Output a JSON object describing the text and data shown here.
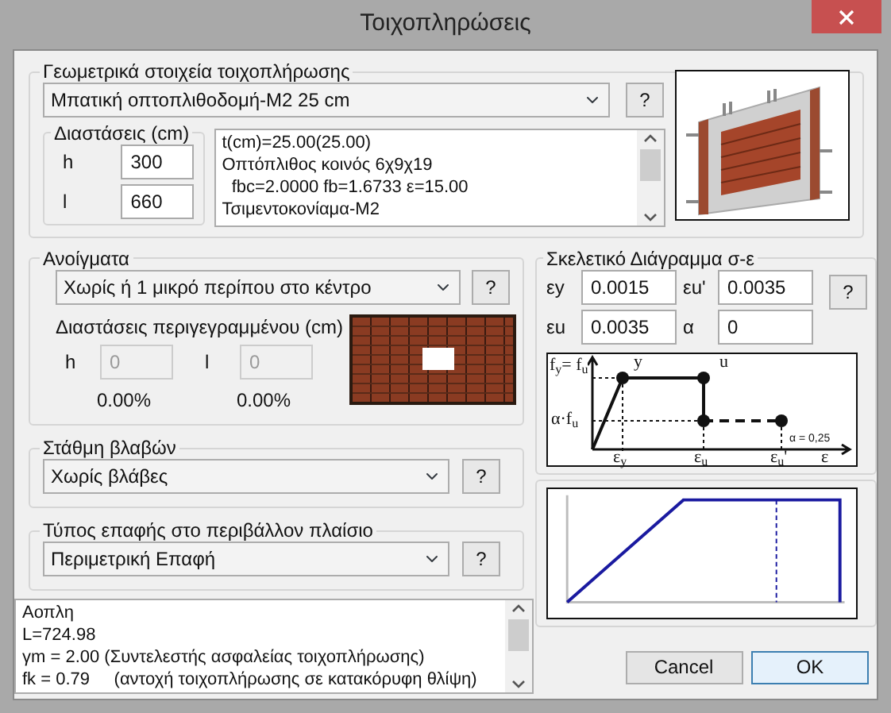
{
  "window": {
    "title": "Τοιχοπληρώσεις"
  },
  "geometry": {
    "label": "Γεωμετρικά στοιχεία τοιχοπλήρωσης",
    "type_select": "Μπατική οπτοπλιθοδομή-Μ2 25 cm",
    "help_button": "?",
    "dimensions": {
      "label": "Διαστάσεις (cm)",
      "fields": [
        {
          "label": "h",
          "value": "300",
          "disabled": false
        },
        {
          "label": "l",
          "value": "660",
          "disabled": false
        }
      ]
    },
    "info_lines": [
      "t(cm)=25.00(25.00)",
      "Οπτόπλιθος κοινός 6χ9χ19",
      "  fbc=2.0000 fb=1.6733 ε=15.00",
      "Τσιμεντοκονίαμα-Μ2"
    ]
  },
  "openings": {
    "label": "Ανοίγματα",
    "select": "Χωρίς ή 1 μικρό περίπου στο κέντρο",
    "help_button": "?",
    "outline_label": "Διαστάσεις περιγεγραμμένου (cm)",
    "fields": [
      {
        "label": "h",
        "value": "0",
        "disabled": true,
        "percent": "0.00%"
      },
      {
        "label": "l",
        "value": "0",
        "disabled": true,
        "percent": "0.00%"
      }
    ]
  },
  "damage": {
    "label": "Στάθμη βλαβών",
    "select": "Χωρίς βλάβες",
    "help_button": "?"
  },
  "contact": {
    "label": "Τύπος επαφής στο περιβάλλον πλαίσιο",
    "select": "Περιμετρική Επαφή",
    "help_button": "?"
  },
  "summary_lines": [
    "Αοπλη",
    "L=724.98",
    "γm = 2.00 (Συντελεστής ασφαλείας τοιχοπλήρωσης)",
    "fk = 0.79     (αντοχή τοιχοπλήρωσης σε κατακόρυφη θλίψη)"
  ],
  "skeleton": {
    "label": "Σκελετικό Διάγραμμα σ-ε",
    "help_button": "?",
    "fields": [
      {
        "label": "εy",
        "value": "0.0015"
      },
      {
        "label": "εu'",
        "value": "0.0035"
      },
      {
        "label": "εu",
        "value": "0.0035"
      },
      {
        "label": "α",
        "value": "0"
      }
    ],
    "diagram_labels": [
      "f$_{y}$= f$_{u}$",
      "y",
      "u",
      "α·f$_{u}$",
      "ε$_{y}$",
      "ε$_{u}$",
      "ε$_{u}$'",
      "ε",
      "α = 0,25"
    ]
  },
  "buttons": [
    {
      "label": "Cancel",
      "default": false
    },
    {
      "label": "OK",
      "default": true
    }
  ]
}
